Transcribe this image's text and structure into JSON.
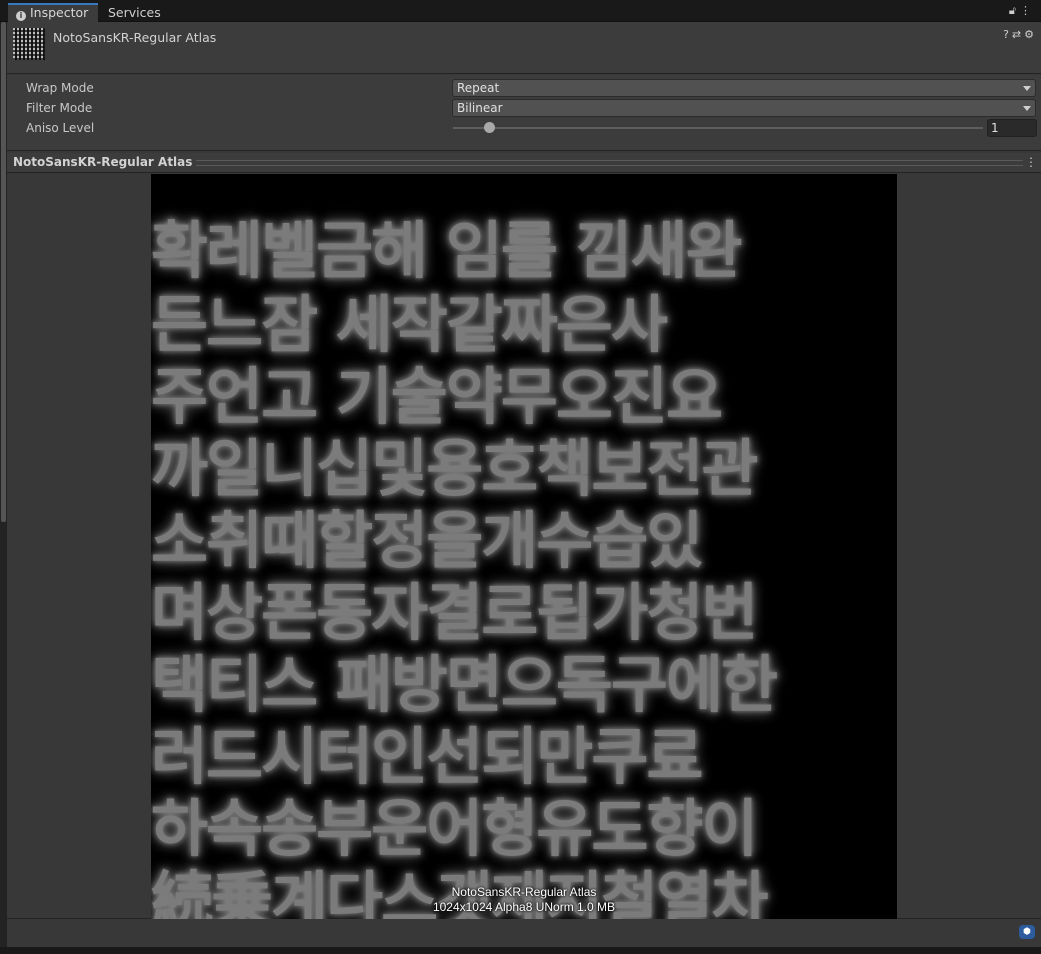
{
  "tabs": [
    {
      "label": "Inspector",
      "icon": "info-icon",
      "active": true
    },
    {
      "label": "Services",
      "active": false
    }
  ],
  "header": {
    "title": "NotoSansKR-Regular Atlas",
    "icons": [
      "help-icon",
      "preset-icon",
      "settings-icon"
    ]
  },
  "props": {
    "wrap_mode": {
      "label": "Wrap Mode",
      "value": "Repeat"
    },
    "filter_mode": {
      "label": "Filter Mode",
      "value": "Bilinear"
    },
    "aniso_level": {
      "label": "Aniso Level",
      "value": "1",
      "slider_fraction": 0.0
    }
  },
  "preview": {
    "title": "NotoSansKR-Regular Atlas",
    "atlas_rows": [
      "확레벨금해   임를 낌새완",
      "든느잠   세작같짜은사",
      "주언고  기술약무오진요",
      "까일니십및용호책보전관",
      " 소취때할정을개수습있",
      "며상폰동자결로됩가청번",
      "택티스 패방면으독구에한",
      "러드시터인선되만쿠료",
      "하속송부운어형유도향이",
      "続乗계다스갯제지철열차"
    ],
    "caption_name": "NotoSansKR-Regular Atlas",
    "caption_info": "1024x1024  Alpha8 UNorm  1.0 MB"
  },
  "footer": {
    "icon": "asset-label-icon"
  },
  "colors": {
    "accent": "#3a79bb",
    "panel": "#383838",
    "header": "#3c3c3c",
    "tag": "#2c5c9e"
  }
}
